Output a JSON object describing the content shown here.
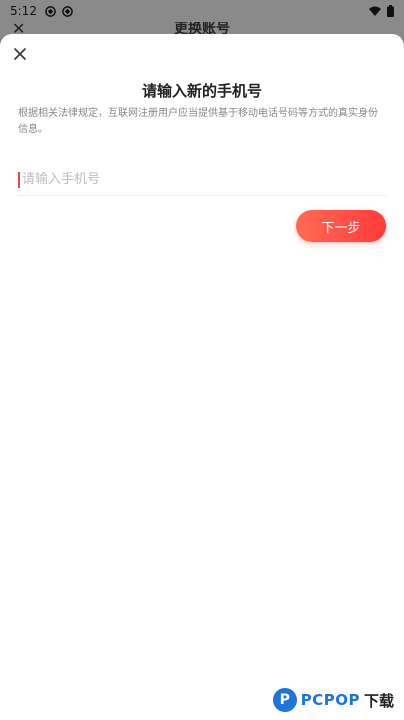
{
  "status_bar": {
    "time": "5:12",
    "left_icons": [
      "app-icon",
      "app-icon"
    ],
    "right_icons": [
      "wifi-icon",
      "battery-icon"
    ]
  },
  "background_page": {
    "title": "更换账号"
  },
  "sheet": {
    "title": "请输入新的手机号",
    "notice": "根据相关法律规定，互联网注册用户应当提供基于移动电话号码等方式的真实身份信息。",
    "phone_input": {
      "value": "",
      "placeholder": "请输入手机号"
    },
    "next_label": "下一步"
  },
  "watermark": {
    "logo_letter": "P",
    "brand": "PCPOP",
    "suffix": "下载"
  },
  "colors": {
    "accent": "#ff4a45",
    "caret": "#e5484d",
    "brand_blue": "#1e74d8"
  }
}
